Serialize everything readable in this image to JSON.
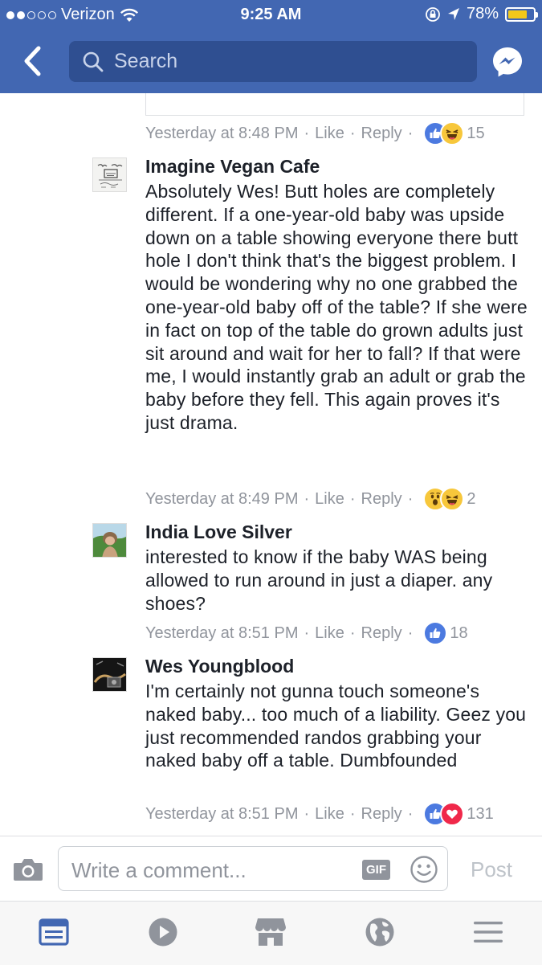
{
  "status_bar": {
    "carrier": "Verizon",
    "time": "9:25 AM",
    "battery": "78%",
    "battery_level": 0.78
  },
  "header": {
    "search_placeholder": "Search"
  },
  "previous_comment": {
    "timestamp": "Yesterday at 8:48 PM",
    "like_label": "Like",
    "reply_label": "Reply",
    "reaction_count": "15",
    "reactions": [
      "like",
      "haha"
    ]
  },
  "comments": [
    {
      "author": "Imagine Vegan Cafe",
      "text": "Absolutely Wes!  Butt holes are completely different.  If a one-year-old baby was upside down on a table showing everyone there butt hole I don't think that's the biggest problem.  I would be wondering why no one grabbed the one-year-old baby off of the table?  If she were in fact on top of the table do grown adults just sit around and wait for her to fall?    If that were me, I would instantly grab an adult or grab the baby before they fell.   This again proves it's just drama.",
      "timestamp": "Yesterday at 8:49 PM",
      "like_label": "Like",
      "reply_label": "Reply",
      "reaction_count": "2",
      "reactions": [
        "wow",
        "haha"
      ]
    },
    {
      "author": "India Love Silver",
      "text": "interested to know if the baby WAS being allowed to run around in just a diaper. any shoes?",
      "timestamp": "Yesterday at 8:51 PM",
      "like_label": "Like",
      "reply_label": "Reply",
      "reaction_count": "18",
      "reactions": [
        "like"
      ]
    },
    {
      "author": "Wes Youngblood",
      "text": "I'm certainly not gunna touch someone's naked baby... too much of a liability. Geez you just recommended randos grabbing your naked baby off a table. Dumbfounded",
      "timestamp": "Yesterday at 8:51 PM",
      "like_label": "Like",
      "reply_label": "Reply",
      "reaction_count": "131",
      "reactions": [
        "like",
        "love"
      ]
    }
  ],
  "composer": {
    "placeholder": "Write a comment...",
    "gif_label": "GIF",
    "post_label": "Post"
  },
  "tabs": [
    "news-feed-icon",
    "video-icon",
    "marketplace-icon",
    "globe-icon",
    "menu-icon"
  ],
  "colors": {
    "brand": "#4267b2",
    "search_bg": "#2f4f91",
    "like_blue": "#4c7ae0",
    "love_red": "#f0284a",
    "haha_yellow": "#f7c73b",
    "meta_gray": "#90949c",
    "battery_yellow": "#f2c81a"
  }
}
